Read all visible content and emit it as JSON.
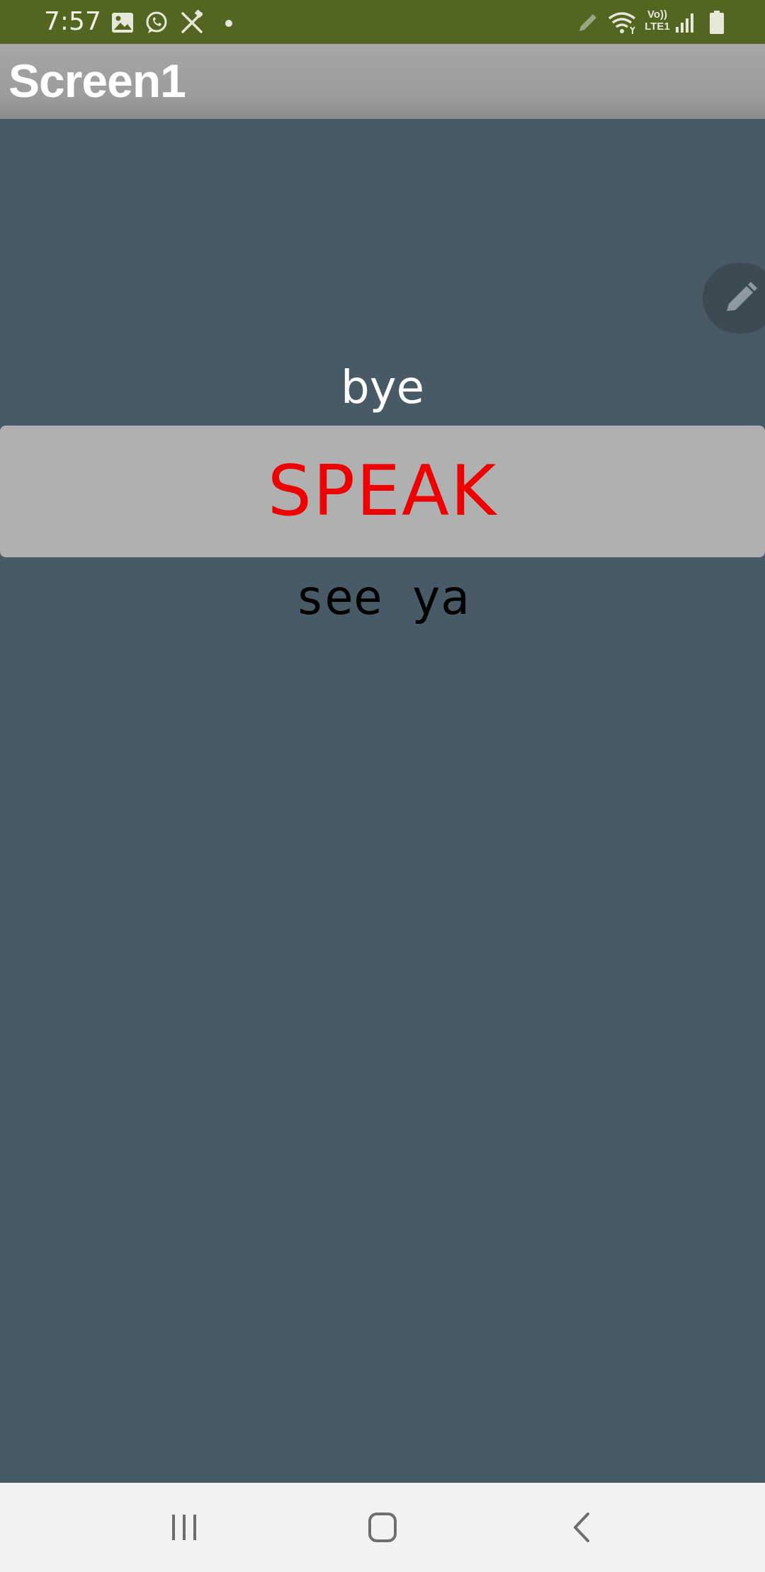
{
  "status_bar": {
    "time": "7:57",
    "network_label": "Vo)) LTE1",
    "icons": [
      "gallery-icon",
      "whatsapp-icon",
      "tools-icon",
      "notification-dot-icon",
      "pencil-icon",
      "wifi-icon",
      "signal-icon",
      "battery-icon"
    ],
    "background_color": "#526622"
  },
  "title_bar": {
    "title": "Screen1"
  },
  "content": {
    "label_top": "bye",
    "speak_button_label": "SPEAK",
    "speak_button_text_color": "#ef0000",
    "label_bottom": "see ya",
    "background_color": "#475a66"
  },
  "fab": {
    "icon": "pencil-icon"
  },
  "nav_bar": {
    "buttons": [
      "recent-apps-icon",
      "home-icon",
      "back-icon"
    ]
  }
}
